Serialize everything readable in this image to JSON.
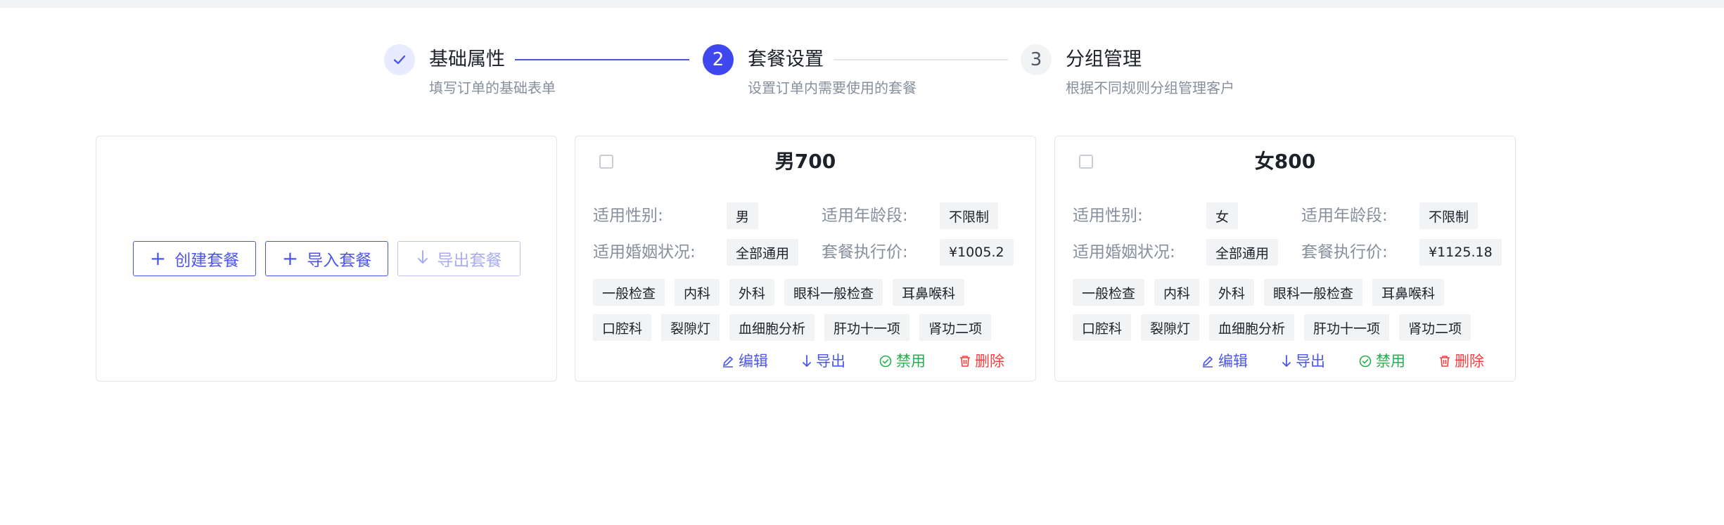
{
  "steps": [
    {
      "number": "1",
      "title": "基础属性",
      "desc": "填写订单的基础表单",
      "status": "done"
    },
    {
      "number": "2",
      "title": "套餐设置",
      "desc": "设置订单内需要使用的套餐",
      "status": "active"
    },
    {
      "number": "3",
      "title": "分组管理",
      "desc": "根据不同规则分组管理客户",
      "status": "wait"
    }
  ],
  "create_card": {
    "create_label": "创建套餐",
    "import_label": "导入套餐",
    "export_label": "导出套餐"
  },
  "labels": {
    "gender": "适用性别:",
    "age": "适用年龄段:",
    "marriage": "适用婚姻状况:",
    "price": "套餐执行价:"
  },
  "packages": [
    {
      "title": "男700",
      "gender": "男",
      "age": "不限制",
      "marriage": "全部通用",
      "price": "¥1005.2",
      "tags_row1": [
        "一般检查",
        "内科",
        "外科",
        "眼科一般检查",
        "耳鼻喉科"
      ],
      "tags_row2": [
        "口腔科",
        "裂隙灯",
        "血细胞分析",
        "肝功十一项",
        "肾功二项"
      ]
    },
    {
      "title": "女800",
      "gender": "女",
      "age": "不限制",
      "marriage": "全部通用",
      "price": "¥1125.18",
      "tags_row1": [
        "一般检查",
        "内科",
        "外科",
        "眼科一般检查",
        "耳鼻喉科"
      ],
      "tags_row2": [
        "口腔科",
        "裂隙灯",
        "血细胞分析",
        "肝功十一项",
        "肾功二项"
      ]
    }
  ],
  "pkg_actions": {
    "edit": "编辑",
    "export": "导出",
    "disable": "禁用",
    "delete": "删除"
  },
  "colors": {
    "primary": "#3f48ef",
    "success": "#27ae4f",
    "danger": "#f53f3f",
    "tag_bg": "#f2f3f5"
  }
}
